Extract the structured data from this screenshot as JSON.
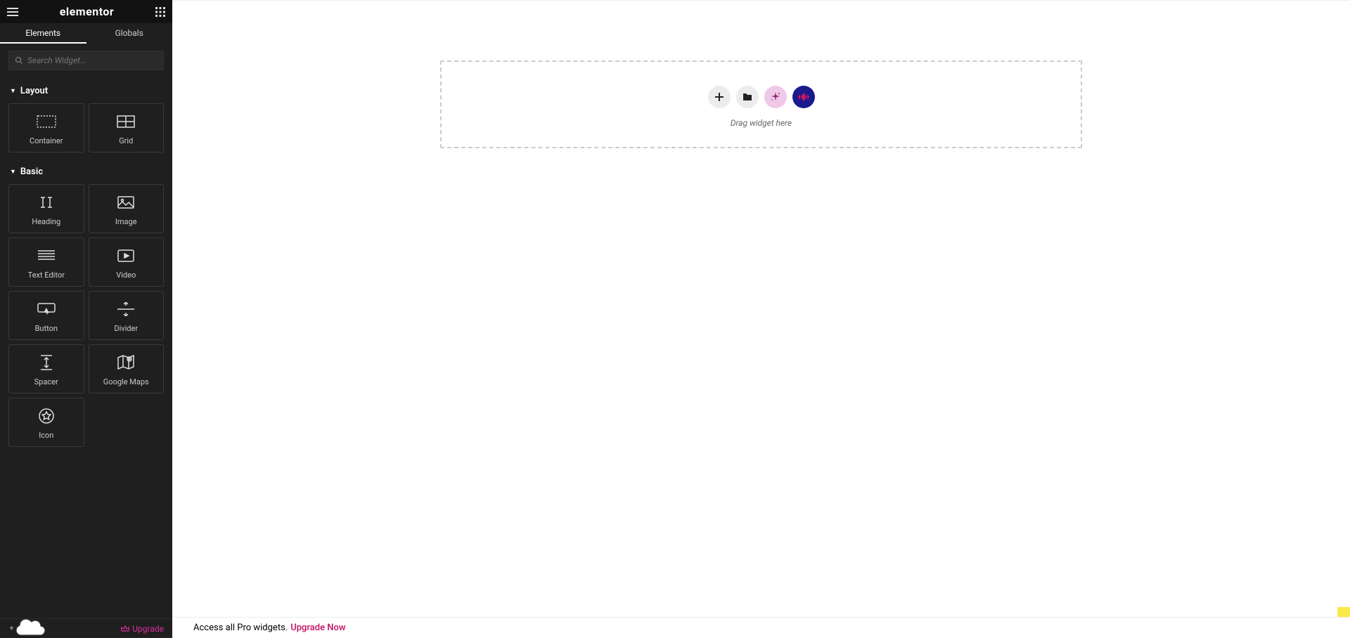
{
  "brand": "elementor",
  "tabs": {
    "elements": "Elements",
    "globals": "Globals"
  },
  "search": {
    "placeholder": "Search Widget..."
  },
  "sections": {
    "layout": {
      "title": "Layout",
      "widgets": [
        {
          "key": "container",
          "label": "Container"
        },
        {
          "key": "grid",
          "label": "Grid"
        }
      ]
    },
    "basic": {
      "title": "Basic",
      "widgets": [
        {
          "key": "heading",
          "label": "Heading"
        },
        {
          "key": "image",
          "label": "Image"
        },
        {
          "key": "text-editor",
          "label": "Text Editor"
        },
        {
          "key": "video",
          "label": "Video"
        },
        {
          "key": "button",
          "label": "Button"
        },
        {
          "key": "divider",
          "label": "Divider"
        },
        {
          "key": "spacer",
          "label": "Spacer"
        },
        {
          "key": "google-maps",
          "label": "Google Maps"
        },
        {
          "key": "icon",
          "label": "Icon"
        }
      ]
    }
  },
  "footer": {
    "upgrade": "Upgrade"
  },
  "dropzone": {
    "hint": "Drag widget here"
  },
  "bottombar": {
    "text": "Access all Pro widgets.",
    "link": "Upgrade Now"
  }
}
